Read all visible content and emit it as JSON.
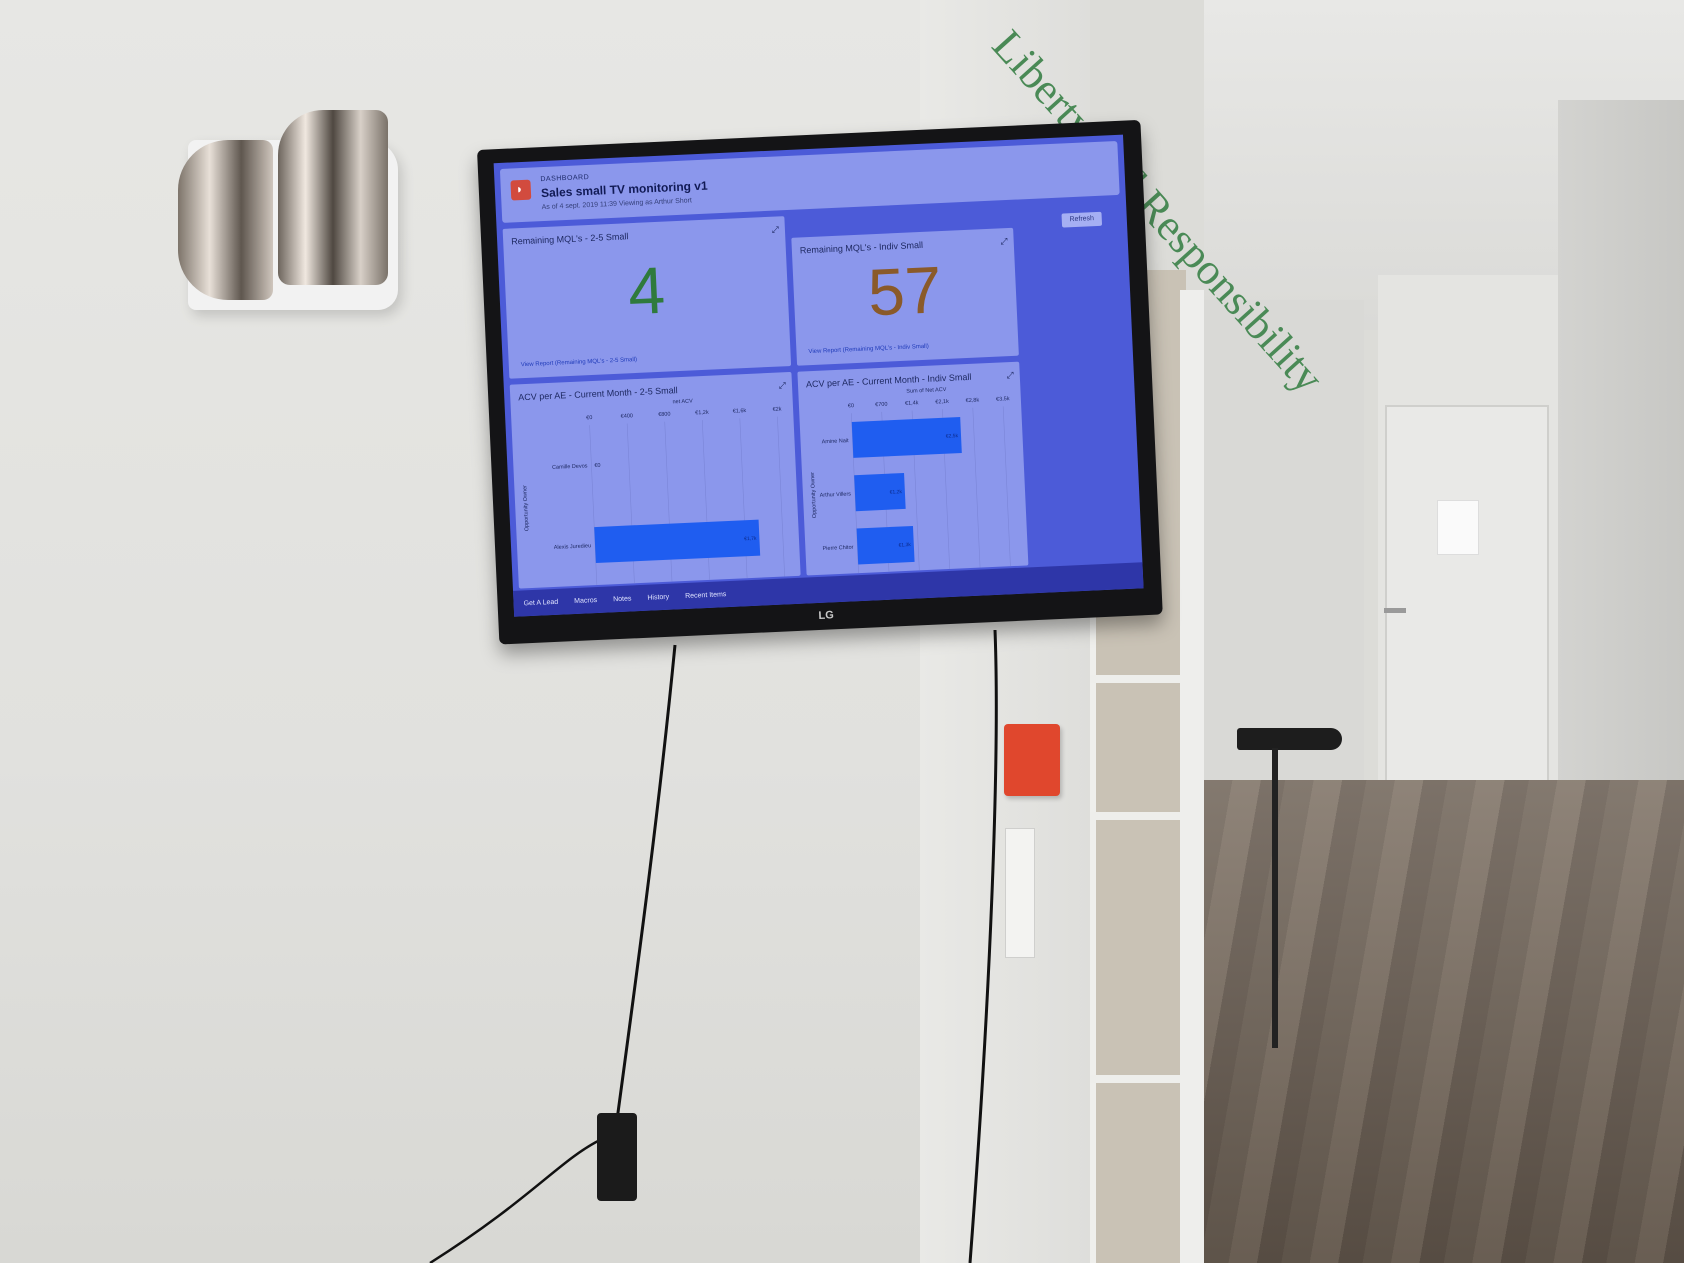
{
  "wall_text": "Liberty and Responsibility",
  "tv_brand": "LG",
  "dashboard": {
    "kicker": "DASHBOARD",
    "title": "Sales small TV monitoring v1",
    "subtitle": "As of 4 sept. 2019 11:39 Viewing as Arthur Short",
    "refresh_label": "Refresh"
  },
  "metrics": [
    {
      "title": "Remaining MQL's - 2-5 Small",
      "value": "4",
      "link": "View Report (Remaining MQL's - 2-5 Small)"
    },
    {
      "title": "Remaining MQL's - Indiv Small",
      "value": "57",
      "link": "View Report (Remaining MQL's - Indiv Small)"
    }
  ],
  "chart_data": [
    {
      "type": "bar",
      "title": "ACV per AE - Current Month - 2-5 Small",
      "xlabel": "net ACV",
      "ylabel": "Opportunity Owner",
      "ticks": [
        "€0",
        "€400",
        "€800",
        "€1,2k",
        "€1,6k",
        "€2k"
      ],
      "xlim": [
        0,
        2000
      ],
      "categories": [
        "Camille Devos",
        "Alexis Juredieu"
      ],
      "values": [
        0,
        1750
      ],
      "labels": [
        "€0",
        "€1,7k"
      ]
    },
    {
      "type": "bar",
      "title": "ACV per AE - Current Month - Indiv Small",
      "xlabel": "Sum of Net ACV",
      "ylabel": "Opportunity Owner",
      "ticks": [
        "€0",
        "€700",
        "€1,4k",
        "€2,1k",
        "€2,8k",
        "€3,5k"
      ],
      "xlim": [
        0,
        3500
      ],
      "categories": [
        "Amine Nait",
        "Arthur Villers",
        "Pierre Chitor"
      ],
      "values": [
        2500,
        1150,
        1300
      ],
      "labels": [
        "€2,5k",
        "€1,2k",
        "€1,3k"
      ]
    }
  ],
  "footer": [
    "Get A Lead",
    "Macros",
    "Notes",
    "History",
    "Recent Items"
  ]
}
